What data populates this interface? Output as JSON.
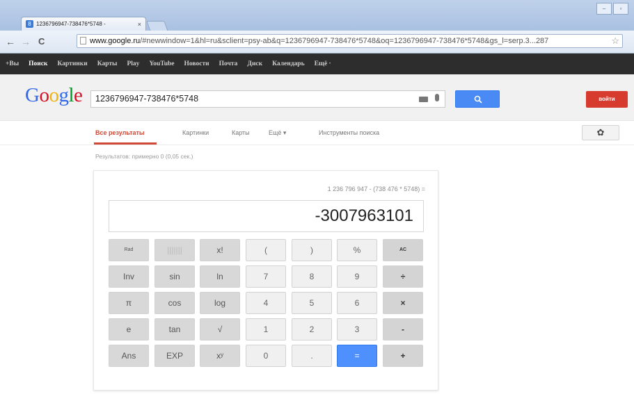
{
  "browser": {
    "tab_title": "1236796947-738476*5748 -",
    "tab_close": "×",
    "tab_favicon": "8",
    "url_host": "www.google.ru",
    "url_rest": "/#newwindow=1&hl=ru&sclient=psy-ab&q=1236796947-738476*5748&oq=1236796947-738476*5748&gs_l=serp.3...287",
    "back": "←",
    "forward": "→",
    "reload": "C",
    "star": "☆",
    "win_min": "–",
    "win_max": "▫",
    "win_close": ""
  },
  "gbar": {
    "items": [
      "+Вы",
      "Поиск",
      "Картинки",
      "Карты",
      "Play",
      "YouTube",
      "Новости",
      "Почта",
      "Диск",
      "Календарь",
      "Ещё ·"
    ]
  },
  "header": {
    "search_value": "1236796947-738476*5748",
    "signin_label": "войти"
  },
  "subnav": {
    "tabs": [
      "Все результаты",
      "Картинки",
      "Карты",
      "Ещё ▾",
      "Инструменты поиска"
    ],
    "gear": "✿"
  },
  "results_stats": "Результатов: примерно 0 (0,05 сек.)",
  "calculator": {
    "expression": "1 236 796 947 - (738 476 * 5748) =",
    "result": "-3007963101",
    "keys": [
      "Rad",
      "|||||||",
      "x!",
      "(",
      ")",
      "%",
      "AC",
      "Inv",
      "sin",
      "ln",
      "7",
      "8",
      "9",
      "÷",
      "π",
      "cos",
      "log",
      "4",
      "5",
      "6",
      "×",
      "e",
      "tan",
      "√",
      "1",
      "2",
      "3",
      "-",
      "Ans",
      "EXP",
      "xʸ",
      "0",
      ".",
      "=",
      "+"
    ]
  },
  "colors": {
    "accent_blue": "#4a8af4",
    "signin_red": "#d63b2e",
    "active_tab_red": "#d14836"
  }
}
